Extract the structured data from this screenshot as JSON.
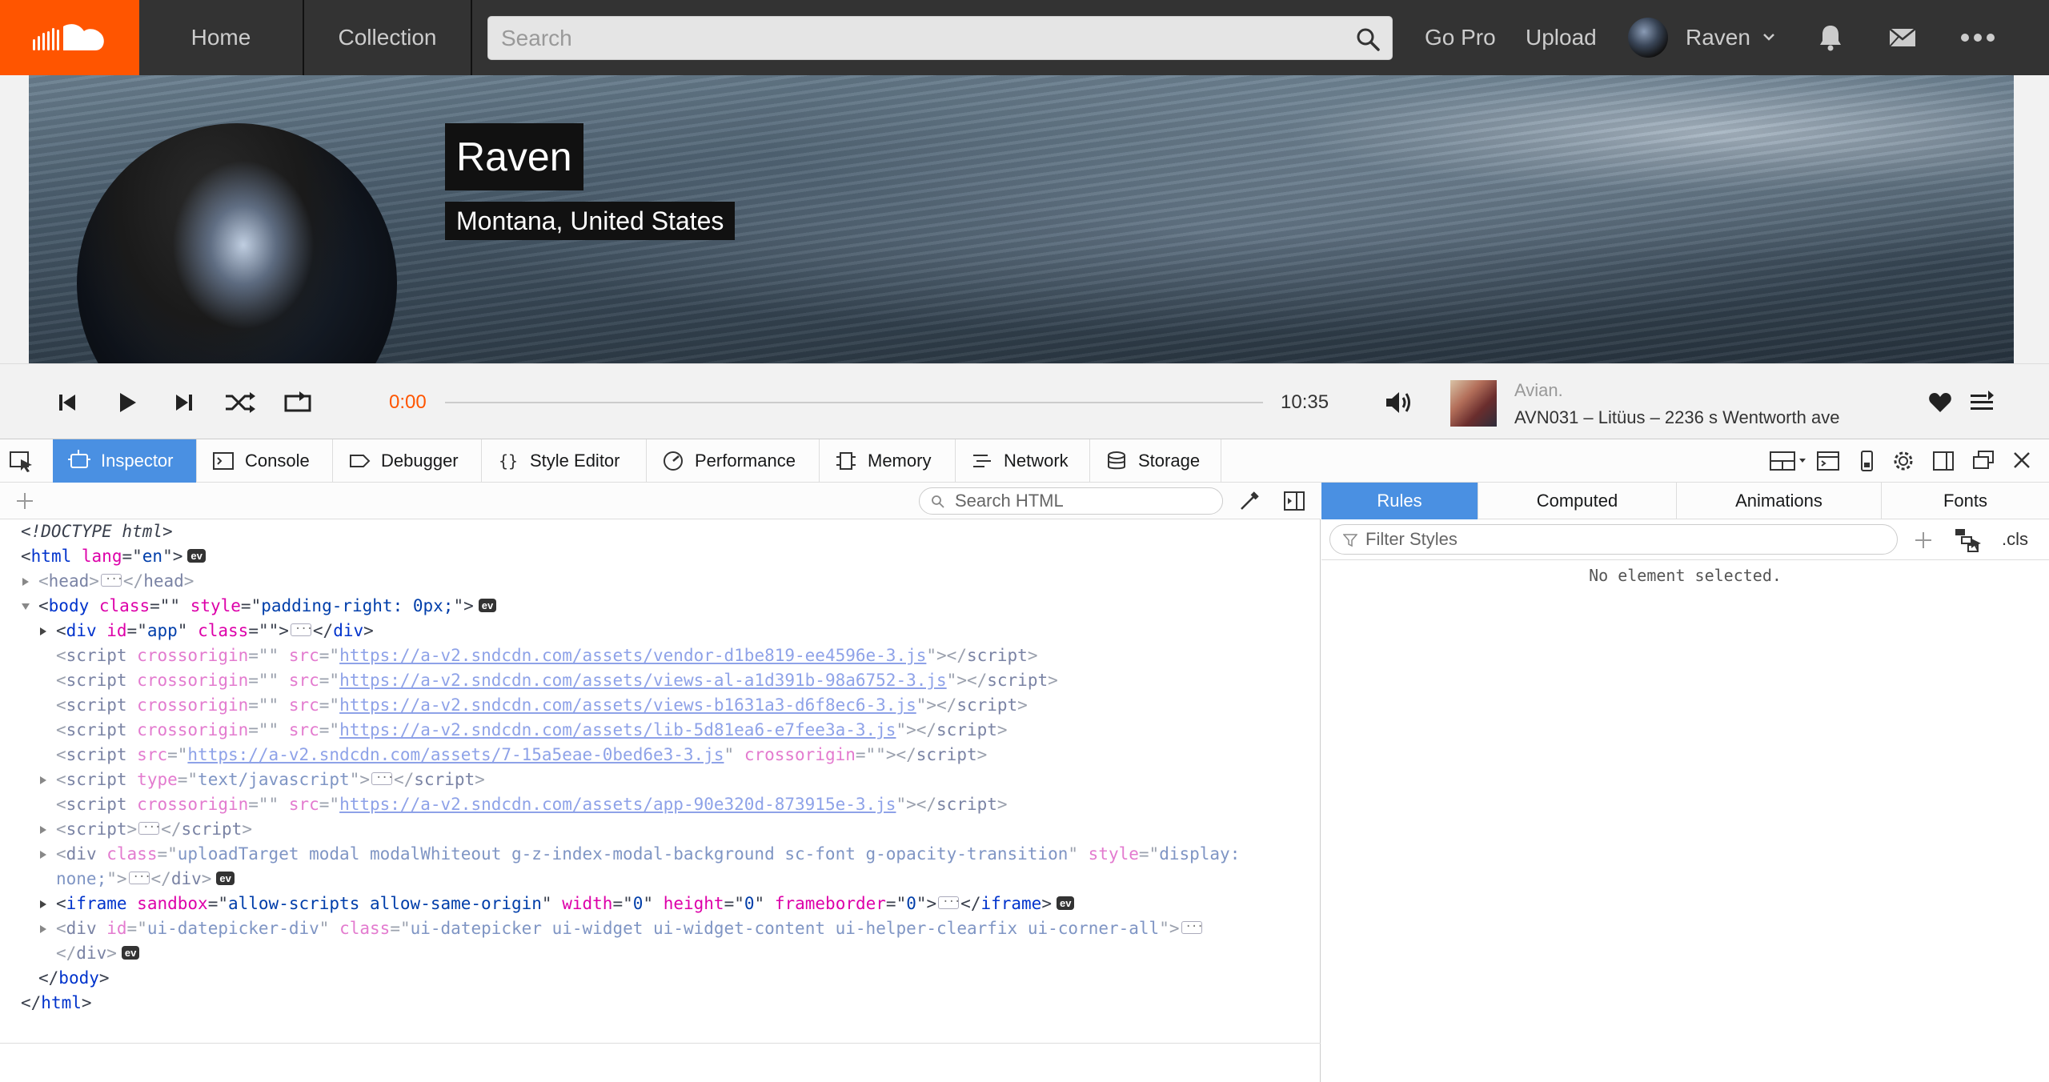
{
  "header": {
    "nav": {
      "home": "Home",
      "collection": "Collection",
      "go_pro": "Go Pro",
      "upload": "Upload"
    },
    "search_placeholder": "Search",
    "user_name": "Raven",
    "icons": [
      "soundcloud-logo",
      "search-icon",
      "chevron-down-icon",
      "bell-icon",
      "mail-icon",
      "more-icon"
    ]
  },
  "profile": {
    "name": "Raven",
    "location": "Montana, United States"
  },
  "player": {
    "current_time": "0:00",
    "total_time": "10:35",
    "progress_fraction": 0,
    "track_artist": "Avian.",
    "track_title": "AVN031 – Litüus – 2236 s Wentworth ave"
  },
  "devtools": {
    "tabs": [
      {
        "label": "Inspector",
        "active": true
      },
      {
        "label": "Console"
      },
      {
        "label": "Debugger"
      },
      {
        "label": "Style Editor"
      },
      {
        "label": "Performance"
      },
      {
        "label": "Memory"
      },
      {
        "label": "Network"
      },
      {
        "label": "Storage"
      }
    ],
    "search_html_placeholder": "Search HTML",
    "markup": {
      "doctype": "<!DOCTYPE html>",
      "html_lang": "en",
      "body_style": "padding-right: 0px;",
      "app_id": "app",
      "scripts": [
        "https://a-v2.sndcdn.com/assets/vendor-d1be819-ee4596e-3.js",
        "https://a-v2.sndcdn.com/assets/views-al-a1d391b-98a6752-3.js",
        "https://a-v2.sndcdn.com/assets/views-b1631a3-d6f8ec6-3.js",
        "https://a-v2.sndcdn.com/assets/lib-5d81ea6-e7fee3a-3.js",
        "https://a-v2.sndcdn.com/assets/7-15a5eae-0bed6e3-3.js",
        "https://a-v2.sndcdn.com/assets/app-90e320d-873915e-3.js"
      ],
      "script_type": "text/javascript",
      "upload_class": "uploadTarget modal modalWhiteout g-z-index-modal-background sc-font g-opacity-transition",
      "upload_style_1": "display:",
      "upload_style_2": "none;",
      "iframe_sandbox": "allow-scripts allow-same-origin",
      "iframe_width": "0",
      "iframe_height": "0",
      "iframe_frameborder": "0",
      "datepicker_id": "ui-datepicker-div",
      "datepicker_class": "ui-datepicker ui-widget ui-widget-content ui-helper-clearfix ui-corner-all",
      "ev_badge": "ev"
    },
    "sidebar": {
      "tabs": [
        {
          "label": "Rules",
          "active": true
        },
        {
          "label": "Computed"
        },
        {
          "label": "Animations"
        },
        {
          "label": "Fonts"
        }
      ],
      "filter_placeholder": "Filter Styles",
      "cls_label": ".cls",
      "empty_message": "No element selected."
    }
  },
  "colors": {
    "brand_orange": "#ff5500",
    "header_bg": "#333333",
    "devtools_accent": "#4a90e2"
  }
}
